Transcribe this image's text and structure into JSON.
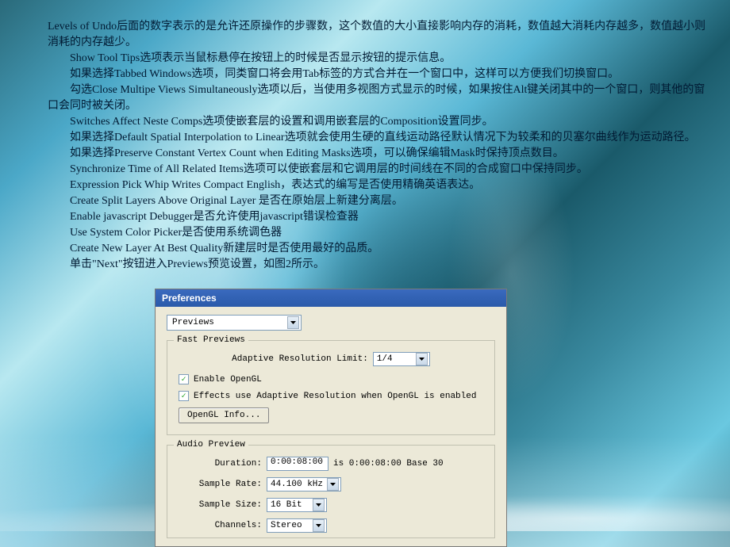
{
  "doc": {
    "p1": "Levels of Undo后面的数字表示的是允许还原操作的步骤数，这个数值的大小直接影响内存的消耗，数值越大消耗内存越多，数值越小则消耗的内存越少。",
    "p2": "Show Tool Tips选项表示当鼠标悬停在按钮上的时候是否显示按钮的提示信息。",
    "p3": "如果选择Tabbed Windows选项，同类窗口将会用Tab标签的方式合并在一个窗口中，这样可以方便我们切换窗口。",
    "p4": "勾选Close Multipe Views Simultaneously选项以后，当使用多视图方式显示的时候，如果按住Alt键关闭其中的一个窗口，则其他的窗口会同时被关闭。",
    "p5": "Switches Affect Neste Comps选项使嵌套层的设置和调用嵌套层的Composition设置同步。",
    "p6": "如果选择Default Spatial Interpolation to Linear选项就会使用生硬的直线运动路径默认情况下为较柔和的贝塞尔曲线作为运动路径。",
    "p7": "如果选择Preserve Constant Vertex Count when Editing Masks选项，可以确保编辑Mask时保持顶点数目。",
    "p8": "Synchronize Time of All Related Items选项可以使嵌套层和它调用层的时间线在不同的合成窗口中保持同步。",
    "p9": "Expression Pick Whip Writes Compact English，表达式的编写是否使用精确英语表达。",
    "p10": "Create Split Layers Above Original Layer 是否在原始层上新建分离层。",
    "p11": "Enable javascript Debugger是否允许使用javascript错误检查器",
    "p12": "Use System Color Picker是否使用系统调色器",
    "p13": "Create New Layer At Best Quality新建层时是否使用最好的品质。",
    "p14": "单击\"Next\"按钮进入Previews预览设置，如图2所示。"
  },
  "dialog": {
    "title": "Preferences",
    "section_dd": "Previews",
    "fast": {
      "legend": "Fast Previews",
      "ar_label": "Adaptive Resolution Limit:",
      "ar_value": "1/4",
      "cb1_label": "Enable OpenGL",
      "cb2_label": "Effects use Adaptive Resolution when OpenGL is enabled",
      "btn": "OpenGL Info..."
    },
    "audio": {
      "legend": "Audio Preview",
      "dur_label": "Duration:",
      "dur_value": "0:00:08:00",
      "dur_note": "is 0:00:08:00  Base 30",
      "rate_label": "Sample Rate:",
      "rate_value": "44.100 kHz",
      "size_label": "Sample Size:",
      "size_value": "16 Bit",
      "ch_label": "Channels:",
      "ch_value": "Stereo"
    }
  }
}
